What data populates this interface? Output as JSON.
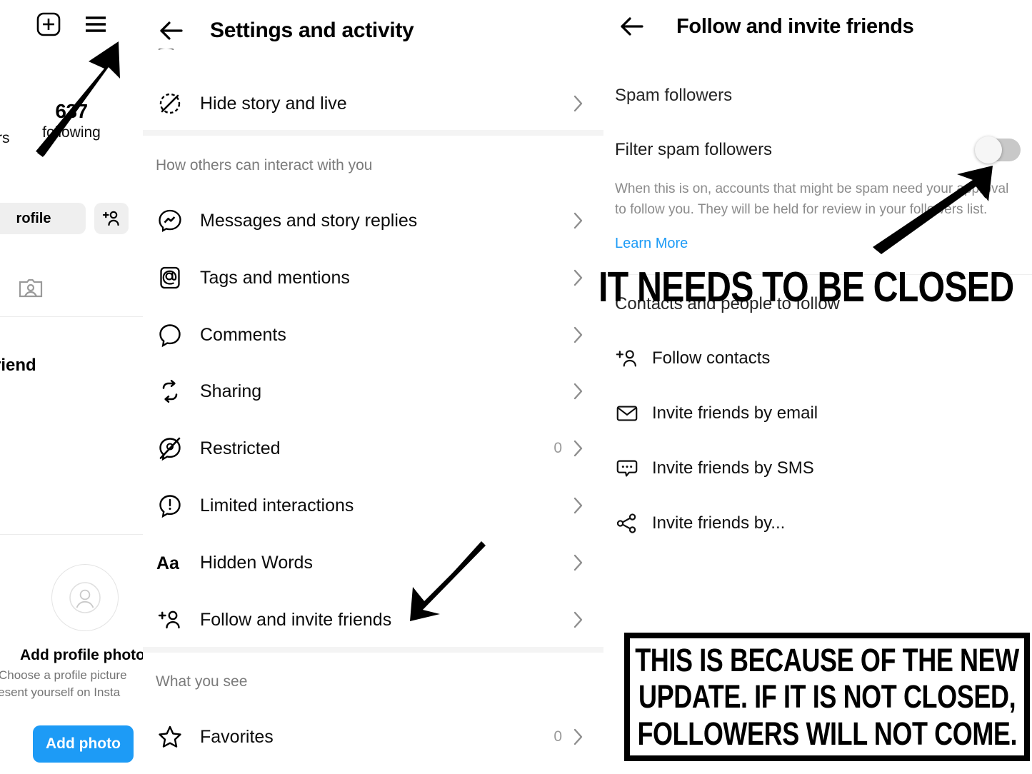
{
  "left_panel": {
    "following_count": "637",
    "following_label": "following",
    "followers_label_cut": "rs",
    "edit_profile_button": "rofile",
    "add_person_icon": "person-add-icon",
    "plus_icon": "new-post-icon",
    "menu_icon": "hamburger-menu-icon",
    "tagged_icon": "tagged-photos-icon",
    "friend_heading_cut": "a friend",
    "add_profile_photo_title": "Add profile photo",
    "add_profile_photo_line1": "Choose a profile picture",
    "add_profile_photo_line2": "present yourself on Insta",
    "add_photo_button": "Add photo",
    "accent_blue": "#1d9bf6"
  },
  "middle_panel": {
    "back_icon": "back-arrow-icon",
    "title": "Settings and activity",
    "cut_row_glyph": "⁀",
    "rows_top": [
      {
        "label": "Hide story and live",
        "icon": "hide-story-icon",
        "count": ""
      }
    ],
    "section_interact": "How others can interact with you",
    "rows_interact": [
      {
        "label": "Messages and story replies",
        "icon": "messenger-icon",
        "count": ""
      },
      {
        "label": "Tags and mentions",
        "icon": "at-mention-icon",
        "count": ""
      },
      {
        "label": "Comments",
        "icon": "comment-bubble-icon",
        "count": ""
      },
      {
        "label": "Sharing",
        "icon": "share-repost-icon",
        "count": ""
      },
      {
        "label": "Restricted",
        "icon": "restricted-icon",
        "count": "0"
      },
      {
        "label": "Limited interactions",
        "icon": "limited-interactions-icon",
        "count": ""
      },
      {
        "label": "Hidden Words",
        "icon": "hidden-words-icon",
        "count": ""
      },
      {
        "label": "Follow and invite friends",
        "icon": "person-add-icon",
        "count": ""
      }
    ],
    "section_whatyousee": "What you see",
    "rows_whatyousee": [
      {
        "label": "Favorites",
        "icon": "star-icon",
        "count": "0"
      }
    ]
  },
  "right_panel": {
    "back_icon": "back-arrow-icon",
    "title": "Follow and invite friends",
    "spam_section": "Spam followers",
    "filter_label": "Filter spam followers",
    "filter_toggle_state": "off",
    "filter_description": "When this is on, accounts that might be spam need your approval to follow you. They will be held for review in your followers list.",
    "learn_more": "Learn More",
    "contacts_section": "Contacts and people to follow",
    "contact_rows": [
      {
        "label": "Follow contacts",
        "icon": "person-add-icon"
      },
      {
        "label": "Invite friends by email",
        "icon": "envelope-icon"
      },
      {
        "label": "Invite friends by SMS",
        "icon": "sms-bubble-icon"
      },
      {
        "label": "Invite friends by...",
        "icon": "share-nodes-icon"
      }
    ]
  },
  "annotations": {
    "arrow_to_menu": "arrow-pointing-to-hamburger-menu",
    "arrow_to_toggle": "arrow-pointing-to-toggle",
    "arrow_to_follow_invite": "arrow-pointing-to-follow-and-invite-friends",
    "headline": "IT NEEDS TO BE CLOSED",
    "callout_line1": "THIS IS BECAUSE OF THE NEW",
    "callout_line2": "UPDATE. IF IT IS NOT CLOSED,",
    "callout_line3": "FOLLOWERS WILL NOT COME."
  }
}
